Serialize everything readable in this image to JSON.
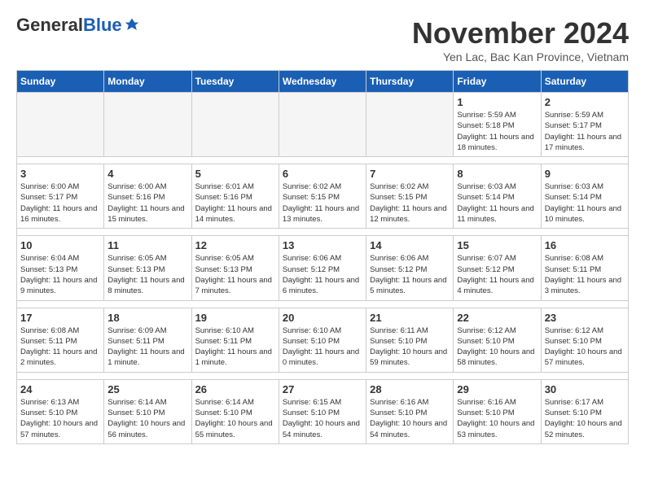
{
  "logo": {
    "general": "General",
    "blue": "Blue"
  },
  "title": "November 2024",
  "subtitle": "Yen Lac, Bac Kan Province, Vietnam",
  "headers": [
    "Sunday",
    "Monday",
    "Tuesday",
    "Wednesday",
    "Thursday",
    "Friday",
    "Saturday"
  ],
  "weeks": [
    [
      {
        "day": "",
        "info": ""
      },
      {
        "day": "",
        "info": ""
      },
      {
        "day": "",
        "info": ""
      },
      {
        "day": "",
        "info": ""
      },
      {
        "day": "",
        "info": ""
      },
      {
        "day": "1",
        "info": "Sunrise: 5:59 AM\nSunset: 5:18 PM\nDaylight: 11 hours and 18 minutes."
      },
      {
        "day": "2",
        "info": "Sunrise: 5:59 AM\nSunset: 5:17 PM\nDaylight: 11 hours and 17 minutes."
      }
    ],
    [
      {
        "day": "3",
        "info": "Sunrise: 6:00 AM\nSunset: 5:17 PM\nDaylight: 11 hours and 16 minutes."
      },
      {
        "day": "4",
        "info": "Sunrise: 6:00 AM\nSunset: 5:16 PM\nDaylight: 11 hours and 15 minutes."
      },
      {
        "day": "5",
        "info": "Sunrise: 6:01 AM\nSunset: 5:16 PM\nDaylight: 11 hours and 14 minutes."
      },
      {
        "day": "6",
        "info": "Sunrise: 6:02 AM\nSunset: 5:15 PM\nDaylight: 11 hours and 13 minutes."
      },
      {
        "day": "7",
        "info": "Sunrise: 6:02 AM\nSunset: 5:15 PM\nDaylight: 11 hours and 12 minutes."
      },
      {
        "day": "8",
        "info": "Sunrise: 6:03 AM\nSunset: 5:14 PM\nDaylight: 11 hours and 11 minutes."
      },
      {
        "day": "9",
        "info": "Sunrise: 6:03 AM\nSunset: 5:14 PM\nDaylight: 11 hours and 10 minutes."
      }
    ],
    [
      {
        "day": "10",
        "info": "Sunrise: 6:04 AM\nSunset: 5:13 PM\nDaylight: 11 hours and 9 minutes."
      },
      {
        "day": "11",
        "info": "Sunrise: 6:05 AM\nSunset: 5:13 PM\nDaylight: 11 hours and 8 minutes."
      },
      {
        "day": "12",
        "info": "Sunrise: 6:05 AM\nSunset: 5:13 PM\nDaylight: 11 hours and 7 minutes."
      },
      {
        "day": "13",
        "info": "Sunrise: 6:06 AM\nSunset: 5:12 PM\nDaylight: 11 hours and 6 minutes."
      },
      {
        "day": "14",
        "info": "Sunrise: 6:06 AM\nSunset: 5:12 PM\nDaylight: 11 hours and 5 minutes."
      },
      {
        "day": "15",
        "info": "Sunrise: 6:07 AM\nSunset: 5:12 PM\nDaylight: 11 hours and 4 minutes."
      },
      {
        "day": "16",
        "info": "Sunrise: 6:08 AM\nSunset: 5:11 PM\nDaylight: 11 hours and 3 minutes."
      }
    ],
    [
      {
        "day": "17",
        "info": "Sunrise: 6:08 AM\nSunset: 5:11 PM\nDaylight: 11 hours and 2 minutes."
      },
      {
        "day": "18",
        "info": "Sunrise: 6:09 AM\nSunset: 5:11 PM\nDaylight: 11 hours and 1 minute."
      },
      {
        "day": "19",
        "info": "Sunrise: 6:10 AM\nSunset: 5:11 PM\nDaylight: 11 hours and 1 minute."
      },
      {
        "day": "20",
        "info": "Sunrise: 6:10 AM\nSunset: 5:10 PM\nDaylight: 11 hours and 0 minutes."
      },
      {
        "day": "21",
        "info": "Sunrise: 6:11 AM\nSunset: 5:10 PM\nDaylight: 10 hours and 59 minutes."
      },
      {
        "day": "22",
        "info": "Sunrise: 6:12 AM\nSunset: 5:10 PM\nDaylight: 10 hours and 58 minutes."
      },
      {
        "day": "23",
        "info": "Sunrise: 6:12 AM\nSunset: 5:10 PM\nDaylight: 10 hours and 57 minutes."
      }
    ],
    [
      {
        "day": "24",
        "info": "Sunrise: 6:13 AM\nSunset: 5:10 PM\nDaylight: 10 hours and 57 minutes."
      },
      {
        "day": "25",
        "info": "Sunrise: 6:14 AM\nSunset: 5:10 PM\nDaylight: 10 hours and 56 minutes."
      },
      {
        "day": "26",
        "info": "Sunrise: 6:14 AM\nSunset: 5:10 PM\nDaylight: 10 hours and 55 minutes."
      },
      {
        "day": "27",
        "info": "Sunrise: 6:15 AM\nSunset: 5:10 PM\nDaylight: 10 hours and 54 minutes."
      },
      {
        "day": "28",
        "info": "Sunrise: 6:16 AM\nSunset: 5:10 PM\nDaylight: 10 hours and 54 minutes."
      },
      {
        "day": "29",
        "info": "Sunrise: 6:16 AM\nSunset: 5:10 PM\nDaylight: 10 hours and 53 minutes."
      },
      {
        "day": "30",
        "info": "Sunrise: 6:17 AM\nSunset: 5:10 PM\nDaylight: 10 hours and 52 minutes."
      }
    ]
  ]
}
